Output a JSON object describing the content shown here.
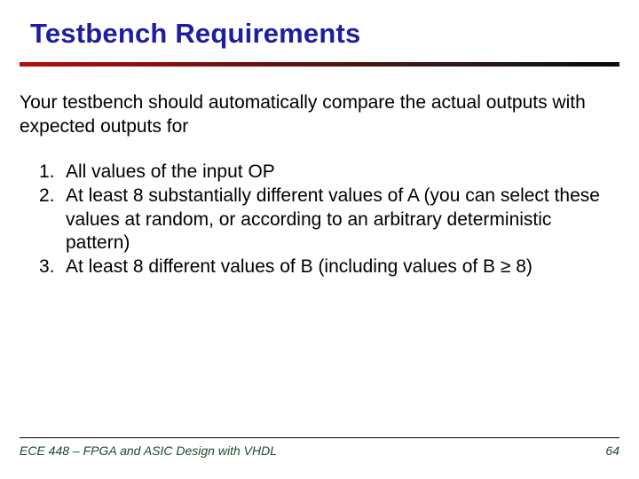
{
  "title": "Testbench Requirements",
  "intro": "Your testbench should automatically compare the actual outputs with expected outputs for",
  "items": [
    {
      "n": "1.",
      "text": "All values of the input OP"
    },
    {
      "n": "2.",
      "text": "At least 8 substantially different values of A (you can select these values at random, or according to an arbitrary deterministic pattern)"
    },
    {
      "n": "3.",
      "text": "At least 8 different values of B (including values of B ≥ 8)"
    }
  ],
  "footer": {
    "course": "ECE 448 – FPGA and ASIC Design with VHDL",
    "page": "64"
  }
}
